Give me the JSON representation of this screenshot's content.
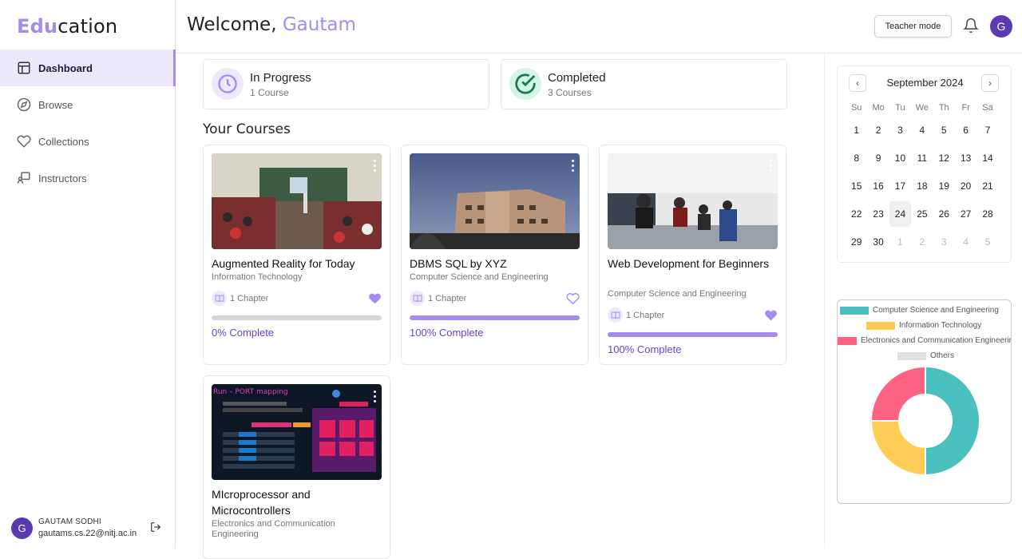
{
  "app": {
    "logo_prefix": "Edu",
    "logo_suffix": "cation"
  },
  "sidebar": {
    "items": [
      {
        "label": "Dashboard",
        "icon": "layout-icon",
        "active": true
      },
      {
        "label": "Browse",
        "icon": "compass-icon"
      },
      {
        "label": "Collections",
        "icon": "heart-icon"
      },
      {
        "label": "Instructors",
        "icon": "presentation-icon"
      }
    ],
    "user": {
      "initial": "G",
      "name": "GAUTAM SODHI",
      "email": "gautams.cs.22@nitj.ac.in"
    }
  },
  "header": {
    "welcome": "Welcome, ",
    "name": "Gautam",
    "teacher_mode": "Teacher mode",
    "avatar_initial": "G"
  },
  "stats": [
    {
      "title": "In Progress",
      "subtitle": "1 Course",
      "icon": "clock-icon",
      "color": "#a58af0"
    },
    {
      "title": "Completed",
      "subtitle": "3 Courses",
      "icon": "check-circle-icon",
      "color": "#10b981"
    }
  ],
  "courses_title": "Your Courses",
  "courses": [
    {
      "title": "Augmented Reality for Today",
      "category": "Information Technology",
      "chapters": "1 Chapter",
      "progress": 0,
      "progress_text": "0% Complete",
      "favorite": true
    },
    {
      "title": "DBMS SQL by XYZ",
      "category": "Computer Science and Engineering",
      "chapters": "1 Chapter",
      "progress": 100,
      "progress_text": "100% Complete",
      "favorite": false
    },
    {
      "title": "Web Development for Beginners",
      "category": "Computer Science and Engineering",
      "chapters": "1 Chapter",
      "progress": 100,
      "progress_text": "100% Complete",
      "favorite": true
    },
    {
      "title": "MIcroprocessor and Microcontrollers",
      "category": "Electronics and Communication Engineering"
    }
  ],
  "thumb4_text": "Run – PORT mapping",
  "calendar": {
    "month": "September 2024",
    "weekdays": [
      "Su",
      "Mo",
      "Tu",
      "We",
      "Th",
      "Fr",
      "Sa"
    ],
    "weeks": [
      [
        "1",
        "2",
        "3",
        "4",
        "5",
        "6",
        "7"
      ],
      [
        "8",
        "9",
        "10",
        "11",
        "12",
        "13",
        "14"
      ],
      [
        "15",
        "16",
        "17",
        "18",
        "19",
        "20",
        "21"
      ],
      [
        "22",
        "23",
        "24",
        "25",
        "26",
        "27",
        "28"
      ],
      [
        "29",
        "30",
        "1",
        "2",
        "3",
        "4",
        "5"
      ]
    ],
    "today": "24"
  },
  "chart_data": {
    "type": "pie",
    "variant": "doughnut",
    "categories": [
      "Computer Science and Engineering",
      "Information Technology",
      "Electronics and Communication Engineering",
      "Others"
    ],
    "values": [
      2,
      1,
      1,
      0
    ],
    "colors": [
      "#4bc0c0",
      "#ffcd56",
      "#ff6384",
      "#e0e0e0"
    ],
    "legend": "top"
  }
}
